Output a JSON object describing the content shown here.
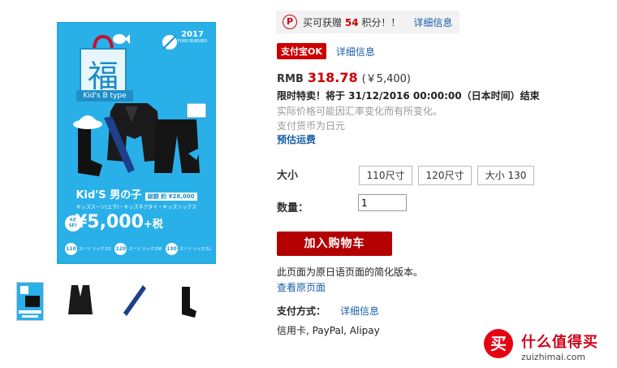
{
  "product_image": {
    "year": "2017",
    "location": "FUKU BUKURO",
    "fuku_char": "福",
    "b_type": "Kid's B type",
    "kids_title": "Kid'S 男の子",
    "total_label": "総額 約 ¥28,000",
    "jp_subtitle": "キッズスーツ(上下)・キッズネクタイ・キッズソックス",
    "set_badge": "4点 SET",
    "price_big": "¥5,000",
    "tax_suffix": "+税",
    "sizes": [
      {
        "num": "110",
        "desc": "スーツ ソックスS"
      },
      {
        "num": "120",
        "desc": "スーツ ソックスM"
      },
      {
        "num": "130",
        "desc": "スーツ ソックスL"
      }
    ]
  },
  "points": {
    "icon": "P",
    "prefix": "买可获赠",
    "value": "54",
    "suffix": "积分！！",
    "link": "详细信息"
  },
  "alipay": {
    "badge": "支付宝OK",
    "link": "详细信息"
  },
  "price": {
    "currency": "RMB",
    "amount": "318.78",
    "yen": "(￥5,400)"
  },
  "sale_text": "限时特卖！将于 31/12/2016 00:00:00（日本时间）结束",
  "notes": [
    "实际价格可能因汇率变化而有所变化。",
    "支付货币为日元"
  ],
  "shipping_link": "预估运费",
  "size": {
    "label": "大小",
    "options": [
      "110尺寸",
      "120尺寸",
      "大小 130"
    ]
  },
  "quantity": {
    "label": "数量：",
    "value": "1"
  },
  "cart_button": "加入购物车",
  "simplified_note": "此页面为原日语页面的简化版本。",
  "original_link": "查看原页面",
  "payment": {
    "label": "支付方式：",
    "link": "详细信息",
    "methods": "信用卡, PayPal, Alipay"
  },
  "watermark": {
    "icon": "买",
    "title": "什么值得买",
    "url": "zuizhimai.com"
  },
  "colors": {
    "accent_red": "#c00000",
    "link_blue": "#1a5fa8",
    "image_blue": "#2ab0e8"
  }
}
